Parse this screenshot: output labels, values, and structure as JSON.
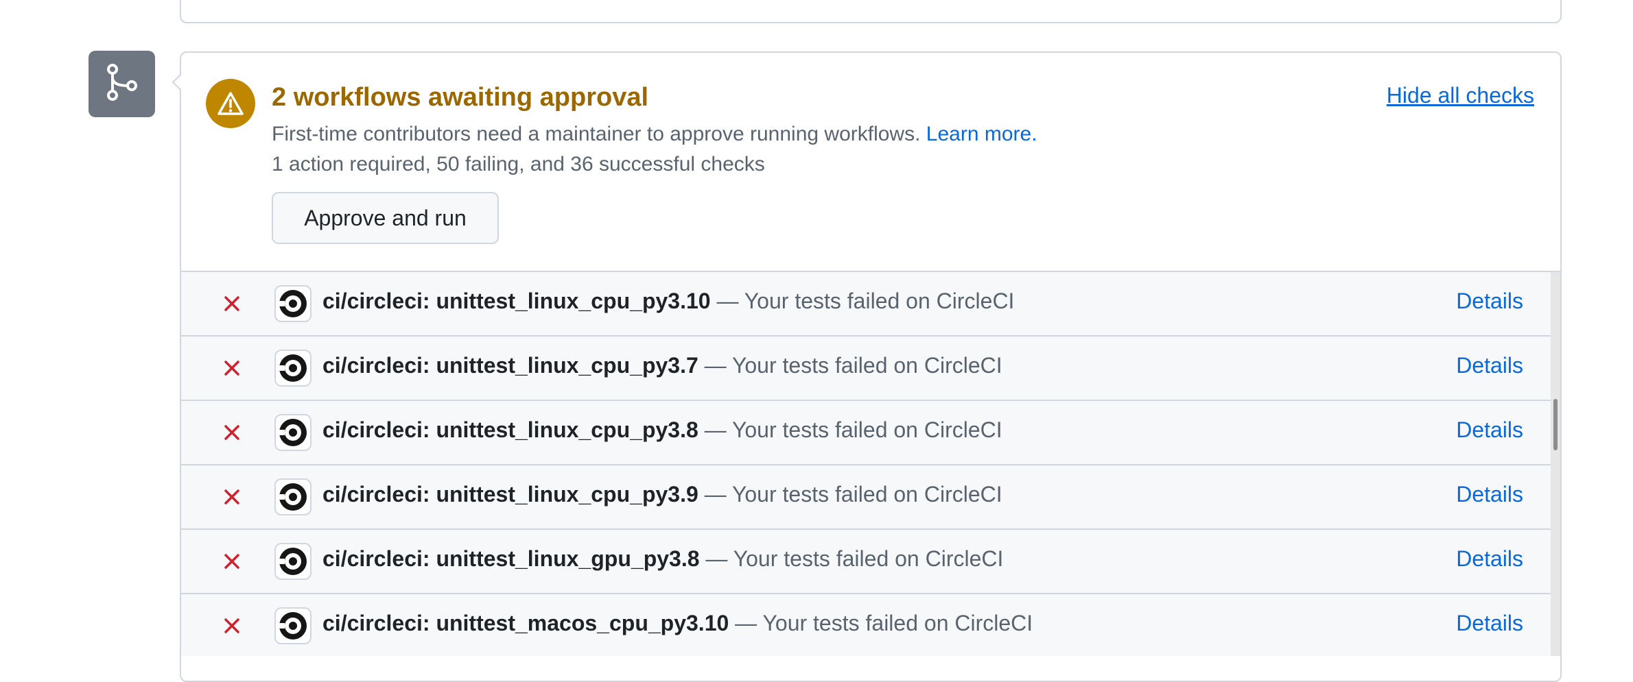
{
  "approval": {
    "title": "2 workflows awaiting approval",
    "description": "First-time contributors need a maintainer to approve running workflows.",
    "learn_more": "Learn more.",
    "summary": "1 action required, 50 failing, and 36 successful checks",
    "approve_button": "Approve and run",
    "hide_checks": "Hide all checks"
  },
  "colors": {
    "warning": "#bf8700",
    "title": "#9a6700",
    "failure": "#cf222e",
    "link": "#0969da"
  },
  "checks": [
    {
      "status": "failure",
      "name": "ci/circleci: unittest_linux_cpu_py3.10",
      "description": " — Your tests failed on CircleCI",
      "link": "Details"
    },
    {
      "status": "failure",
      "name": "ci/circleci: unittest_linux_cpu_py3.7",
      "description": " — Your tests failed on CircleCI",
      "link": "Details"
    },
    {
      "status": "failure",
      "name": "ci/circleci: unittest_linux_cpu_py3.8",
      "description": " — Your tests failed on CircleCI",
      "link": "Details"
    },
    {
      "status": "failure",
      "name": "ci/circleci: unittest_linux_cpu_py3.9",
      "description": " — Your tests failed on CircleCI",
      "link": "Details"
    },
    {
      "status": "failure",
      "name": "ci/circleci: unittest_linux_gpu_py3.8",
      "description": " — Your tests failed on CircleCI",
      "link": "Details"
    },
    {
      "status": "failure",
      "name": "ci/circleci: unittest_macos_cpu_py3.10",
      "description": " — Your tests failed on CircleCI",
      "link": "Details"
    }
  ]
}
